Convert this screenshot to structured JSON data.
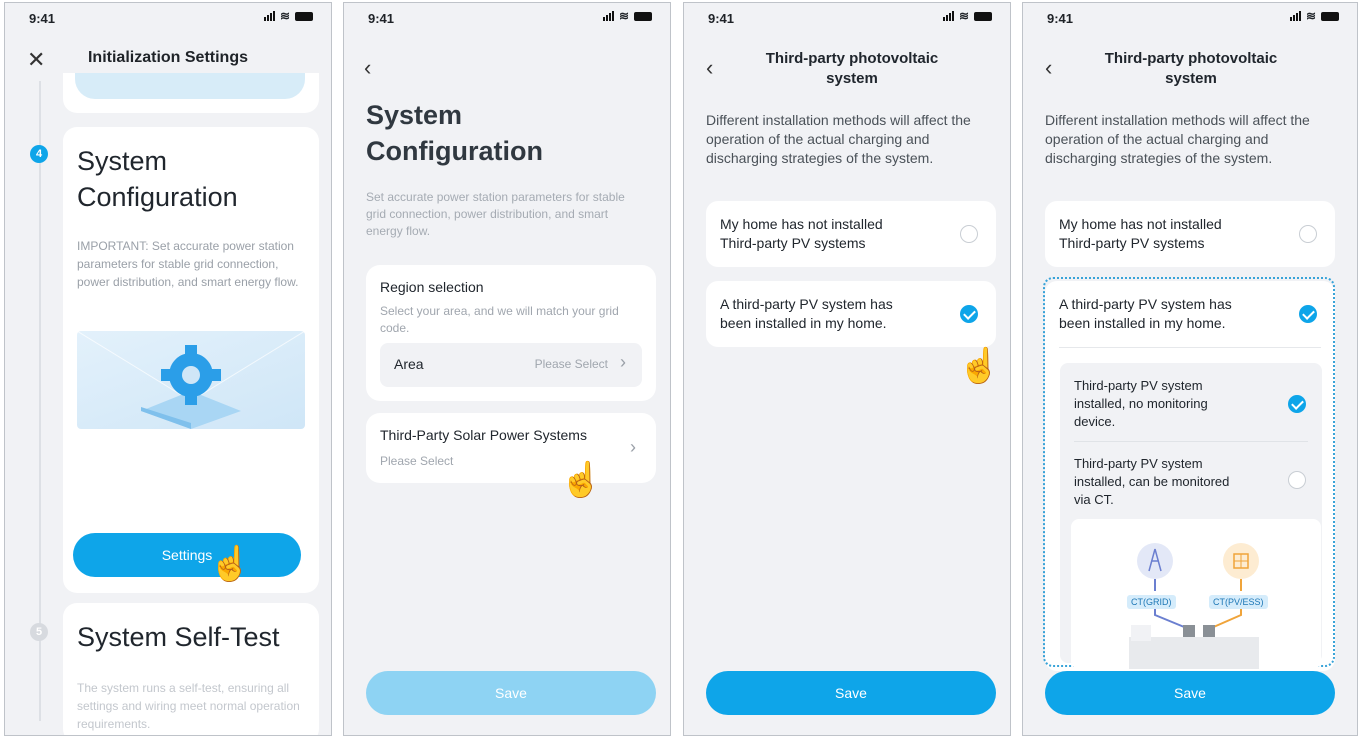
{
  "status": {
    "time": "9:41"
  },
  "screen1": {
    "title": "Initialization Settings",
    "step4": {
      "number": "4",
      "title_line1": "System",
      "title_line2": "Configuration",
      "description": "IMPORTANT: Set accurate power station parameters for stable grid connection, power distribution, and smart energy flow.",
      "button": "Settings"
    },
    "step5": {
      "number": "5",
      "title": "System Self-Test",
      "description": "The system runs a self-test, ensuring all settings and wiring meet normal operation requirements."
    }
  },
  "screen2": {
    "title_line1": "System",
    "title_line2": "Configuration",
    "description": "Set accurate power station parameters for stable grid connection, power distribution, and smart energy flow.",
    "region": {
      "label": "Region selection",
      "sub": "Select your area, and we will match your grid code.",
      "field_label": "Area",
      "field_value": "Please Select"
    },
    "third_party": {
      "label": "Third-Party Solar Power Systems",
      "value": "Please Select"
    },
    "save": "Save"
  },
  "screen3": {
    "title_line1": "Third-party photovoltaic",
    "title_line2": "system",
    "intro": "Different installation methods will affect the operation of the actual charging and discharging strategies of the system.",
    "option1_line1": "My home has not installed",
    "option1_line2": "Third-party PV systems",
    "option2_line1": "A third-party PV system has",
    "option2_line2": "been installed in my home.",
    "save": "Save"
  },
  "screen4": {
    "title_line1": "Third-party photovoltaic",
    "title_line2": "system",
    "intro": "Different installation methods will affect the operation of the actual charging and discharging strategies of the system.",
    "option1_line1": "My home has not installed",
    "option1_line2": "Third-party PV systems",
    "option2_line1": "A third-party PV system has",
    "option2_line2": "been installed in my home.",
    "sub1_line1": "Third-party PV system",
    "sub1_line2": "installed, no monitoring",
    "sub1_line3": "device.",
    "sub2_line1": "Third-party PV system",
    "sub2_line2": "installed, can be monitored",
    "sub2_line3": "via CT.",
    "ct_grid": "CT(GRID)",
    "ct_pv": "CT(PV/ESS)",
    "save": "Save"
  },
  "colors": {
    "accent": "#0ea5e9",
    "save_disabled": "#8ed3f3"
  }
}
